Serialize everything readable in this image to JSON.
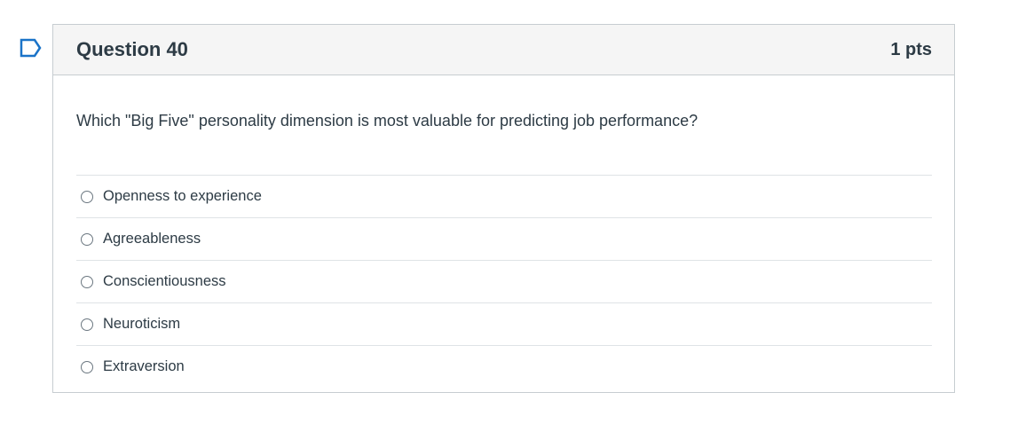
{
  "question": {
    "title": "Question 40",
    "points": "1 pts",
    "text": "Which \"Big Five\" personality dimension is most valuable for predicting job performance?",
    "answers": [
      {
        "label": "Openness to experience",
        "selected": false
      },
      {
        "label": "Agreeableness",
        "selected": false
      },
      {
        "label": "Conscientiousness",
        "selected": false
      },
      {
        "label": "Neuroticism",
        "selected": false
      },
      {
        "label": "Extraversion",
        "selected": false
      }
    ]
  },
  "icons": {
    "flag": "flag-icon",
    "radio": "radio-button-icon"
  },
  "colors": {
    "text": "#2d3b45",
    "header_bg": "#f5f5f5",
    "border": "#c7cdd1",
    "flag": "#1a73c8"
  }
}
